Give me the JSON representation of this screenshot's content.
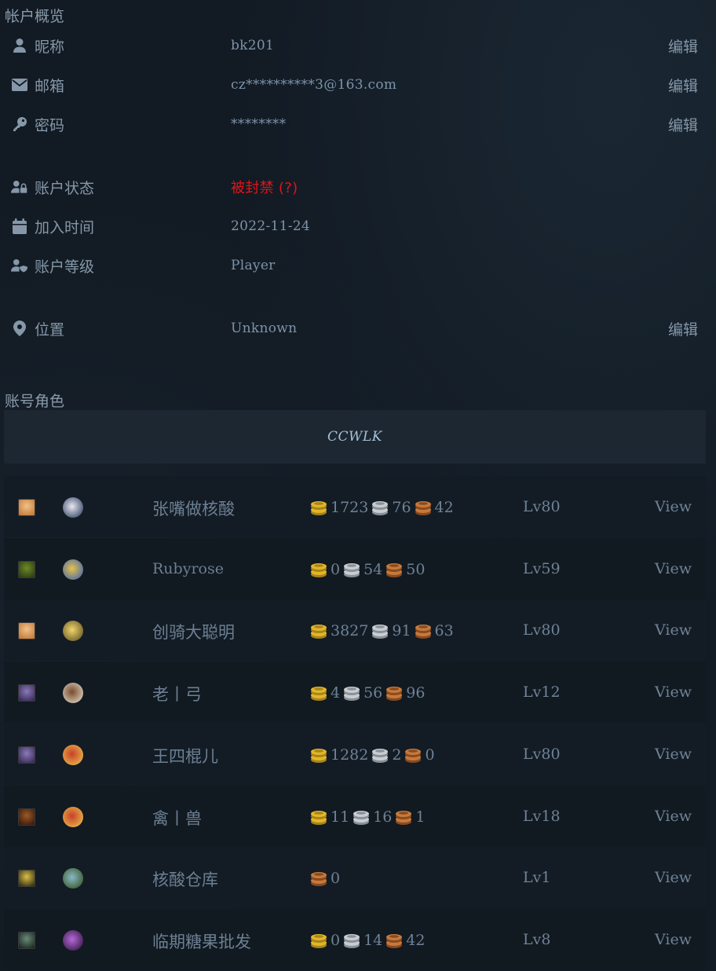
{
  "overview": {
    "title": "帐户概览",
    "rows": [
      {
        "icon": "user-icon",
        "label": "昵称",
        "value": "bk201",
        "edit": "编辑"
      },
      {
        "icon": "envelope-icon",
        "label": "邮箱",
        "value": "cz**********3@163.com",
        "edit": "编辑"
      },
      {
        "icon": "key-icon",
        "label": "密码",
        "value": "********",
        "edit": "编辑"
      },
      {
        "icon": "user-lock-icon",
        "label": "账户状态",
        "value": "被封禁 (?)"
      },
      {
        "icon": "calendar-icon",
        "label": "加入时间",
        "value": "2022-11-24"
      },
      {
        "icon": "user-shield-icon",
        "label": "账户等级",
        "value": "Player"
      },
      {
        "icon": "map-pin-icon",
        "label": "位置",
        "value": "Unknown",
        "edit": "编辑"
      }
    ]
  },
  "characters": {
    "title": "账号角色",
    "realm": "CCWLK",
    "list": [
      {
        "name": "张嘴做核酸",
        "gold": "1723",
        "silver": "76",
        "copper": "42",
        "level": "Lv80",
        "view": "View",
        "race_icon": "human-female-icon",
        "class_icon": "priest-icon"
      },
      {
        "name": "Rubyrose",
        "gold": "0",
        "silver": "54",
        "copper": "50",
        "level": "Lv59",
        "view": "View",
        "race_icon": "orc-male-icon",
        "class_icon": "shaman-icon"
      },
      {
        "name": "创骑大聪明",
        "gold": "3827",
        "silver": "91",
        "copper": "63",
        "level": "Lv80",
        "view": "View",
        "race_icon": "human-female-icon",
        "class_icon": "paladin-icon"
      },
      {
        "name": "老丨弓",
        "gold": "4",
        "silver": "56",
        "copper": "96",
        "level": "Lv12",
        "view": "View",
        "race_icon": "draenei-female-icon",
        "class_icon": "hunter-icon"
      },
      {
        "name": "王四棍儿",
        "gold": "1282",
        "silver": "2",
        "copper": "0",
        "level": "Lv80",
        "view": "View",
        "race_icon": "draenei-female-icon",
        "class_icon": "druid-icon"
      },
      {
        "name": "禽丨兽",
        "gold": "11",
        "silver": "16",
        "copper": "1",
        "level": "Lv18",
        "view": "View",
        "race_icon": "tauren-male-icon",
        "class_icon": "druid-icon"
      },
      {
        "name": "核酸仓库",
        "gold": null,
        "silver": null,
        "copper": "0",
        "level": "Lv1",
        "view": "View",
        "race_icon": "undead-male-icon",
        "class_icon": "warrior-icon"
      },
      {
        "name": "临期糖果批发",
        "gold": "0",
        "silver": "14",
        "copper": "42",
        "level": "Lv8",
        "view": "View",
        "race_icon": "undead-female-icon",
        "class_icon": "warlock-icon"
      }
    ]
  },
  "colors": {
    "background": "#121a23",
    "banned": "#e0141a",
    "gold_coin": "#e2b62a",
    "silver_coin": "#c8cdd2",
    "copper_coin": "#c57a3c"
  }
}
